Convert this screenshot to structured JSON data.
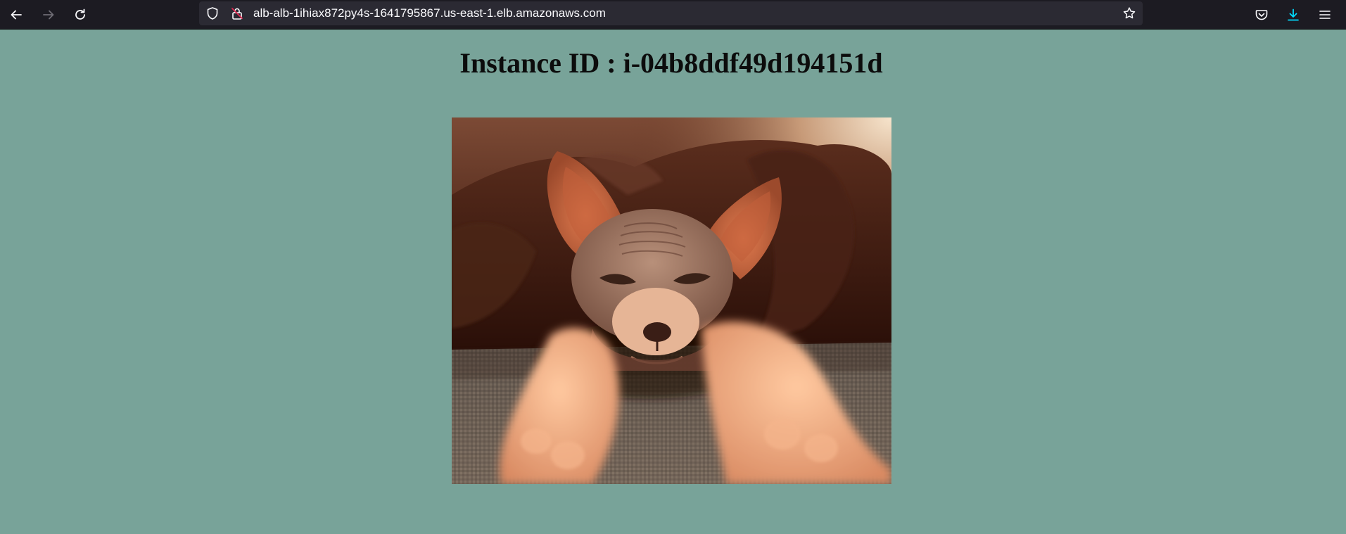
{
  "browser": {
    "url": "alb-alb-1ihiax872py4s-1641795867.us-east-1.elb.amazonaws.com",
    "icons": {
      "back": "arrow-left-icon",
      "forward": "arrow-right-icon",
      "reload": "reload-icon",
      "tracking_protection": "shield-icon",
      "connection": "insecure-lock-icon",
      "bookmark": "star-icon",
      "pocket": "pocket-icon",
      "downloads": "download-icon",
      "menu": "hamburger-menu-icon"
    },
    "colors": {
      "toolbar_bg": "#1c1b22",
      "urlbar_bg": "#2b2a33",
      "download_accent": "#00ddff",
      "insecure_accent": "#e22850"
    }
  },
  "page": {
    "heading": "Instance ID : i-04b8ddf49d194151d",
    "image_subject": "sphynx-cat-photo",
    "colors": {
      "background": "#78a399"
    }
  }
}
